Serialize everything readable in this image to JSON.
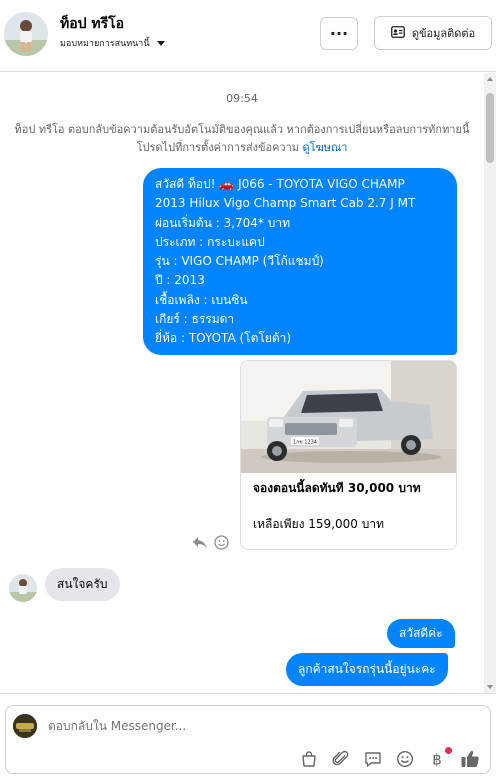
{
  "header": {
    "name": "ท็อป ทรีโอ",
    "assign_label": "มอบหมายการสนทนานี้",
    "contact_button": "ดูข้อมูลติดต่อ",
    "more_label": "···"
  },
  "thread": {
    "time": "09:54",
    "notice_text": "ท็อป ทรีโอ ตอบกลับข้อความต้อนรับอัตโนมัติของคุณแล้ว หากต้องการเปลี่ยนหรือลบการทักทายนี้ โปรดไปที่การตั้งค่าการส่งข้อความ",
    "notice_link": "ดูโฆษณา",
    "welcome_lines": [
      "สวัสดี ท็อป! 🚗 J066 - TOYOTA VIGO CHAMP",
      "2013 Hilux Vigo Champ Smart Cab 2.7 J MT",
      "ผ่อนเริ่มต้น : 3,704* บาท",
      "ประเภท : กระบะแคป",
      "รุ่น : VIGO CHAMP (วีโก้แชมป์)",
      "ปี : 2013",
      "เชื้อเพลิง : เบนซิน",
      "เกียร์ : ธรรมดา",
      "ยี่ห้อ : TOYOTA (โตโยต้า)"
    ],
    "card": {
      "title": "จองตอนนี้ลดทันที 30,000 บาท",
      "subtitle": "เหลือเพียง 159,000 บาท",
      "plate_text": "1กข 1234"
    },
    "incoming_message": "สนใจครับ",
    "reply_1": "สวัสดีค่ะ",
    "reply_2": "ลูกค้าสนใจรถรุ่นนี้อยู่นะคะ"
  },
  "composer": {
    "placeholder": "ตอบกลับใน Messenger..."
  },
  "icons": {
    "more": "more-icon",
    "contact": "contact-card-icon",
    "reply": "reply-icon",
    "emoji": "emoji-icon",
    "shop": "shopping-bag-icon",
    "attach": "paperclip-icon",
    "saved": "saved-replies-icon",
    "currency": "baht-payment-icon",
    "like": "thumbs-up-icon"
  },
  "colors": {
    "brand_blue": "#0084ff",
    "incoming_bubble": "#e4e6eb",
    "notification_dot": "#f02849"
  }
}
